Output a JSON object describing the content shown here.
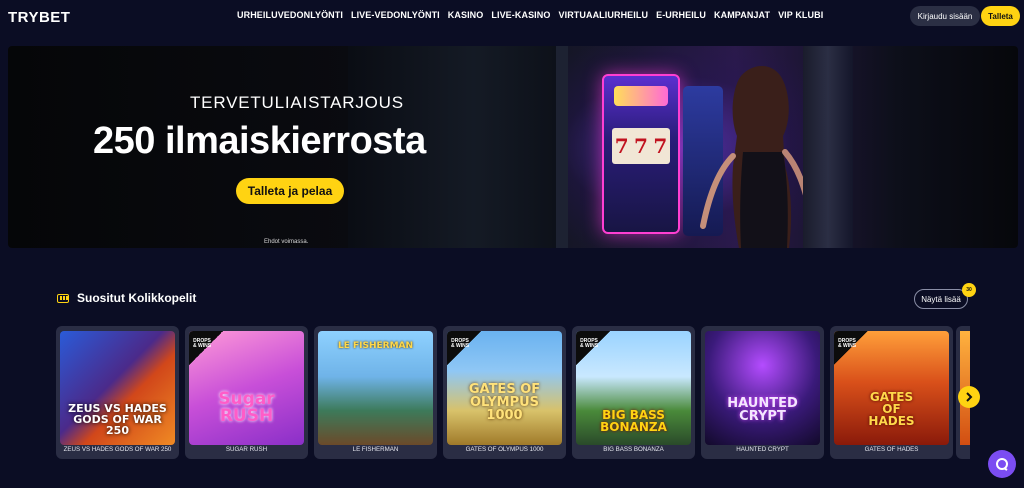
{
  "brand": {
    "logo": "TRYBET"
  },
  "nav": {
    "items": [
      "URHEILUVEDONLYÖNTI",
      "LIVE-VEDONLYÖNTI",
      "KASINO",
      "LIVE-KASINO",
      "VIRTUAALIURHEILU",
      "E-URHEILU",
      "KAMPANJAT",
      "VIP KLUBI"
    ]
  },
  "header": {
    "login_label": "Kirjaudu sisään",
    "deposit_label": "Talleta"
  },
  "hero": {
    "subtitle": "TERVETULIAISTARJOUS",
    "title": "250 ilmaiskierrosta",
    "cta_label": "Talleta ja pelaa",
    "terms": "Ehdot voimassa.",
    "slot_symbols": [
      "7",
      "7",
      "7"
    ]
  },
  "section": {
    "title": "Suositut Kolikkopelit",
    "show_more_label": "Näytä lisää",
    "badge_count": "30"
  },
  "games": [
    {
      "name": "ZEUS VS HADES GODS OF WAR 250",
      "art": "ZEUS VS HADES\nGODS OF WAR 250",
      "drops": false
    },
    {
      "name": "SUGAR RUSH",
      "art": "Sugar\nRUSH",
      "drops": true
    },
    {
      "name": "LE FISHERMAN",
      "art": "LE FISHERMAN",
      "drops": false
    },
    {
      "name": "GATES OF OLYMPUS 1000",
      "art": "GATES OF\nOLYMPUS\n1000",
      "drops": true
    },
    {
      "name": "BIG BASS BONANZA",
      "art": "BIG BASS\nBONANZA",
      "drops": true
    },
    {
      "name": "HAUNTED CRYPT",
      "art": "HAUNTED\nCRYPT",
      "drops": false
    },
    {
      "name": "GATES OF HADES",
      "art": "GATES\nOF\nHADES",
      "drops": true
    }
  ],
  "drops_label": "DROPS\n& WINS",
  "colors": {
    "accent": "#ffd312",
    "background": "#0b0d24",
    "card": "#2a2d44",
    "chat": "#7b4df2"
  },
  "icons": {
    "section": "slot-machine-icon",
    "arrow": "chevron-right-icon",
    "chat": "chat-icon"
  }
}
